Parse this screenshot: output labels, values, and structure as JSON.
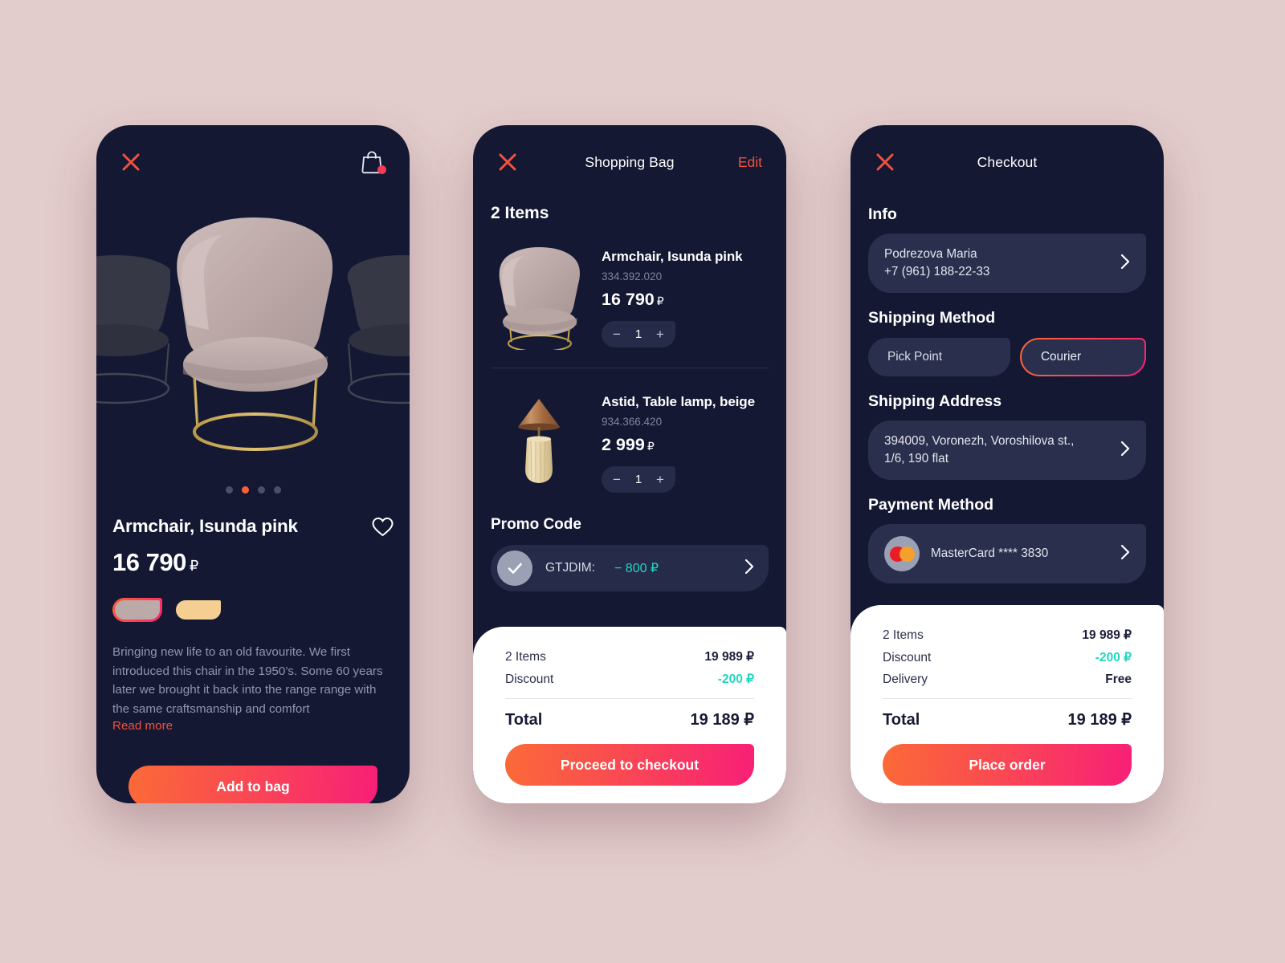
{
  "background_color": "#e3cccc",
  "accent": {
    "orange": "#fb6038",
    "pink": "#f81f77",
    "red_close": "#f4513c",
    "teal": "#1fd8c0",
    "dark_card": "#141833",
    "panel": "#2a2f4d"
  },
  "product_screen": {
    "close_icon": "close-icon",
    "bag_icon": "shopping-bag-icon",
    "bag_has_badge": true,
    "gallery": {
      "dots_count": 4,
      "active_dot_index": 1,
      "main_image_alt": "armchair-pink",
      "side_image_alt": "armchair-preview"
    },
    "title": "Armchair, Isunda pink",
    "favourite_icon": "heart-icon",
    "price": "16 790",
    "currency": "₽",
    "swatches": [
      {
        "name": "pink",
        "color": "#bcaaa9",
        "selected": true
      },
      {
        "name": "beige",
        "color": "#f5cf92",
        "selected": false
      }
    ],
    "description": "Bringing new life to an old favourite. We first introduced this chair in the 1950’s. Some 60 years later we brought it back into the range range with the same craftsmanship and comfort",
    "read_more": "Read more",
    "cta": "Add to bag"
  },
  "bag_screen": {
    "close_icon": "close-icon",
    "title": "Shopping Bag",
    "edit": "Edit",
    "items_count_label": "2 Items",
    "items": [
      {
        "image_alt": "armchair-thumbnail",
        "name": "Armchair, Isunda pink",
        "sku": "334.392.020",
        "price": "16 790",
        "currency": "₽",
        "qty": "1",
        "minus": "−",
        "plus": "+"
      },
      {
        "image_alt": "table-lamp-thumbnail",
        "name": "Astid, Table lamp, beige",
        "sku": "934.366.420",
        "price": "2 999",
        "currency": "₽",
        "qty": "1",
        "minus": "−",
        "plus": "+"
      }
    ],
    "promo": {
      "label": "Promo Code",
      "check_icon": "check-icon",
      "code": "GTJDIM:",
      "amount": "− 800 ₽",
      "chevron_icon": "chevron-right-icon"
    },
    "summary": {
      "rows": [
        {
          "label": "2 Items",
          "value": "19 989 ₽",
          "green": false
        },
        {
          "label": "Discount",
          "value": "-200 ₽",
          "green": true
        }
      ],
      "total_label": "Total",
      "total_value": "19 189 ₽",
      "cta": "Proceed to checkout"
    }
  },
  "checkout_screen": {
    "close_icon": "close-icon",
    "title": "Checkout",
    "info": {
      "heading": "Info",
      "name": "Podrezova Maria",
      "phone": "+7 (961) 188-22-33",
      "chevron_icon": "chevron-right-icon"
    },
    "shipping_method": {
      "heading": "Shipping Method",
      "options": [
        {
          "label": "Pick Point",
          "selected": false
        },
        {
          "label": "Courier",
          "selected": true
        }
      ]
    },
    "shipping_address": {
      "heading": "Shipping Address",
      "line1": "394009, Voronezh, Voroshilova st.,",
      "line2": "1/6, 190 flat",
      "chevron_icon": "chevron-right-icon"
    },
    "payment_method": {
      "heading": "Payment Method",
      "card_icon": "mastercard-icon",
      "card_label": "MasterCard **** 3830",
      "chevron_icon": "chevron-right-icon"
    },
    "summary": {
      "rows": [
        {
          "label": "2 Items",
          "value": "19 989 ₽",
          "green": false
        },
        {
          "label": "Discount",
          "value": "-200 ₽",
          "green": true
        },
        {
          "label": "Delivery",
          "value": "Free",
          "green": false
        }
      ],
      "total_label": "Total",
      "total_value": "19 189 ₽",
      "cta": "Place order"
    }
  }
}
